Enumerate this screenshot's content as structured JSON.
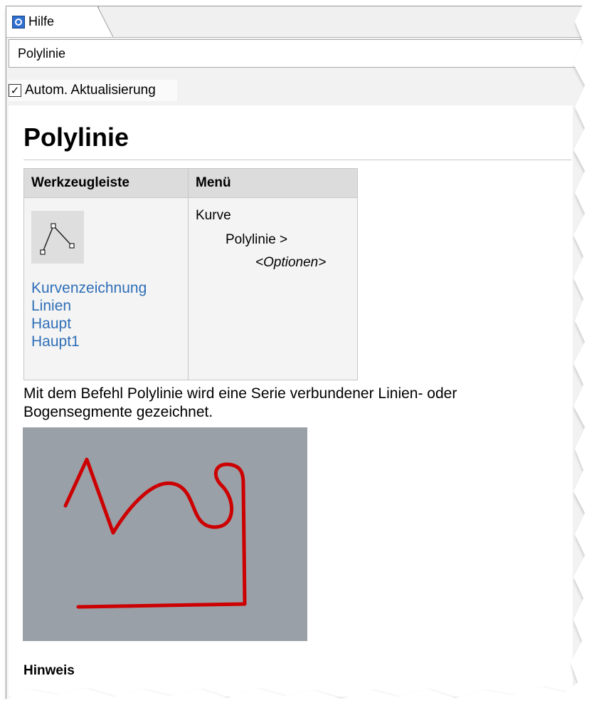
{
  "tab": {
    "label": "Hilfe"
  },
  "search": {
    "value": "Polylinie"
  },
  "autoupdate": {
    "label": "Autom. Aktualisierung",
    "checked": true
  },
  "page": {
    "title": "Polylinie",
    "table": {
      "col_toolbar": "Werkzeugleiste",
      "col_menu": "Menü",
      "toolbar_links": [
        "Kurvenzeichnung",
        "Linien",
        "Haupt",
        "Haupt1"
      ],
      "menu_path": [
        "Kurve",
        "Polylinie >",
        "<Optionen>"
      ]
    },
    "description": "Mit dem Befehl Polylinie wird eine Serie verbundener Linien- oder Bogensegmente gezeichnet.",
    "section_heading": "Hinweis"
  },
  "colors": {
    "link": "#2f6fb8",
    "curve": "#cc0000",
    "illustration_bg": "#9aa0a8"
  }
}
